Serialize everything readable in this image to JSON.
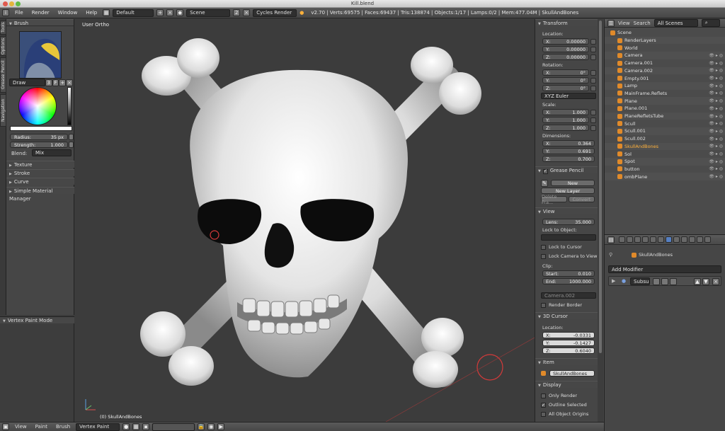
{
  "window": {
    "title": "Kill.blend"
  },
  "header": {
    "menus": [
      "File",
      "Render",
      "Window",
      "Help"
    ],
    "layout": "Default",
    "scene": "Scene",
    "scene_num": "2",
    "render_engine": "Cycles Render",
    "stats": "v2.70 | Verts:69575 | Faces:69437 | Tris:138874 | Objects:1/17 | Lamps:0/2 | Mem:477.04M | SkullAndBones"
  },
  "toolshelf": {
    "tabs": [
      "Tools",
      "Options",
      "Grease Pencil",
      "Navigation"
    ],
    "brush_header": "Brush",
    "brush_name": "Draw",
    "brush_users": "3",
    "brush_f": "F",
    "radius_label": "Radius:",
    "radius_value": "35 px",
    "strength_label": "Strength:",
    "strength_value": "1.000",
    "blend_label": "Blend:",
    "blend_value": "Mix",
    "collapsed": [
      "Texture",
      "Stroke",
      "Curve",
      "Simple Material Manager"
    ],
    "operator_header": "Vertex Paint Mode"
  },
  "viewport": {
    "label": "User Ortho",
    "active_object": "(0) SkullAndBones"
  },
  "npanel": {
    "transform": "Transform",
    "location": "Location:",
    "loc": [
      {
        "axis": "X:",
        "val": "0.00000"
      },
      {
        "axis": "Y:",
        "val": "0.00000"
      },
      {
        "axis": "Z:",
        "val": "0.00000"
      }
    ],
    "rotation": "Rotation:",
    "rot": [
      {
        "axis": "X:",
        "val": "0°"
      },
      {
        "axis": "Y:",
        "val": "0°"
      },
      {
        "axis": "Z:",
        "val": "0°"
      }
    ],
    "rot_mode": "XYZ Euler",
    "scale": "Scale:",
    "scl": [
      {
        "axis": "X:",
        "val": "1.000"
      },
      {
        "axis": "Y:",
        "val": "1.000"
      },
      {
        "axis": "Z:",
        "val": "1.000"
      }
    ],
    "dimensions": "Dimensions:",
    "dim": [
      {
        "axis": "X:",
        "val": "0.364"
      },
      {
        "axis": "Y:",
        "val": "0.691"
      },
      {
        "axis": "Z:",
        "val": "0.700"
      }
    ],
    "grease_pencil": "Grease Pencil",
    "gp_new": "New",
    "gp_new_layer": "New Layer",
    "gp_delete": "Delete Fra...",
    "gp_convert": "Convert",
    "view": "View",
    "lens_label": "Lens:",
    "lens_value": "35.000",
    "lock_object": "Lock to Object:",
    "lock_cursor": "Lock to Cursor",
    "lock_camera": "Lock Camera to View",
    "clip": "Clip:",
    "clip_start_label": "Start:",
    "clip_start": "0.010",
    "clip_end_label": "End:",
    "clip_end": "1000.000",
    "local_camera": "Camera.002",
    "render_border": "Render Border",
    "cursor": "3D Cursor",
    "cursor_location": "Location:",
    "cur": [
      {
        "axis": "X:",
        "val": "-0.0331"
      },
      {
        "axis": "Y:",
        "val": "-0.1427"
      },
      {
        "axis": "Z:",
        "val": "0.6040"
      }
    ],
    "item": "Item",
    "item_name": "SkullAndBones",
    "display": "Display",
    "only_render": "Only Render",
    "outline_selected": "Outline Selected",
    "all_object_origins": "All Object Origins"
  },
  "outliner": {
    "menus": [
      "View",
      "Search"
    ],
    "filter": "All Scenes",
    "rows": [
      "Scene",
      "RenderLayers",
      "World",
      "Camera",
      "Camera.001",
      "Camera.002",
      "Empty.001",
      "Lamp",
      "MainFrame.Reflets",
      "Plane",
      "Plane.001",
      "PlaneRefletsTube",
      "Scull",
      "Scull.001",
      "Scull.002",
      "SkullAndBones",
      "Sol",
      "Spot",
      "button",
      "ombPlane"
    ]
  },
  "properties": {
    "object": "SkullAndBones",
    "add_modifier": "Add Modifier",
    "modifier_name": "Subsu"
  },
  "bottom": {
    "menus": [
      "View",
      "Paint",
      "Brush"
    ],
    "mode": "Vertex Paint"
  }
}
